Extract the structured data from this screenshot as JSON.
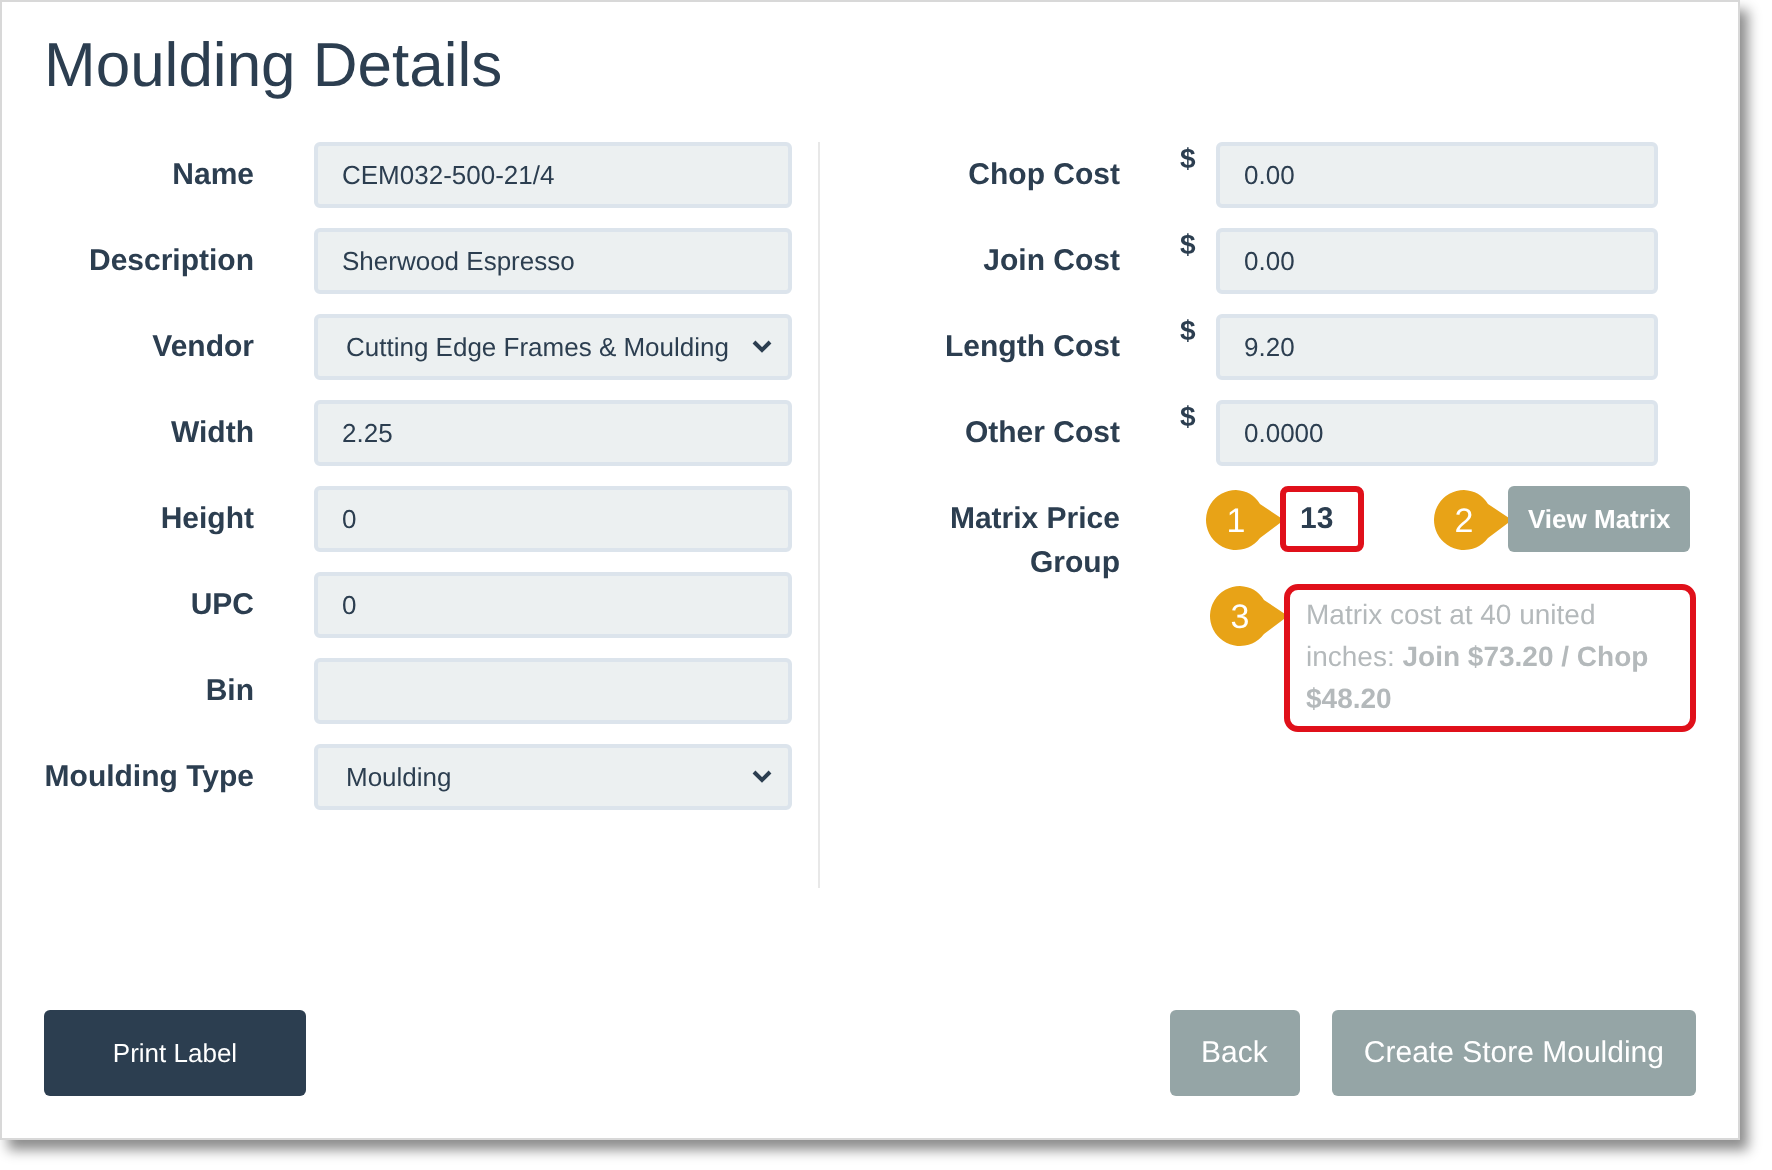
{
  "title": "Moulding Details",
  "left_fields": [
    {
      "label": "Name",
      "kind": "text",
      "value": "CEM032-500-21/4"
    },
    {
      "label": "Description",
      "kind": "text",
      "value": "Sherwood Espresso"
    },
    {
      "label": "Vendor",
      "kind": "select",
      "value": "Cutting Edge Frames & Moulding"
    },
    {
      "label": "Width",
      "kind": "text",
      "value": "2.25"
    },
    {
      "label": "Height",
      "kind": "text",
      "value": "0"
    },
    {
      "label": "UPC",
      "kind": "text",
      "value": "0"
    },
    {
      "label": "Bin",
      "kind": "text"
    },
    {
      "label": "Moulding Type",
      "kind": "select",
      "value": "Moulding"
    }
  ],
  "right_fields": [
    {
      "label": "Chop Cost",
      "currency": "$",
      "value": "0.00"
    },
    {
      "label": "Join Cost",
      "currency": "$",
      "value": "0.00"
    },
    {
      "label": "Length Cost",
      "currency": "$",
      "value": "9.20"
    },
    {
      "label": "Other Cost",
      "currency": "$",
      "value": "0.0000"
    }
  ],
  "matrix_price_group": {
    "label": "Matrix Price Group",
    "value": {
      "text": "13",
      "highlighted": true,
      "callout": "1"
    },
    "button": {
      "label": "View Matrix",
      "highlighted": false,
      "callout": "2"
    },
    "note": {
      "text": "Matrix cost at 40 united inches: **Join $73.20 / Chop $48.20**",
      "highlighted": true,
      "callout": "3"
    }
  },
  "buttons": [
    {
      "label": "Print Label",
      "kind": "primary"
    },
    {
      "label": "Back",
      "kind": "secondary"
    },
    {
      "label": "Create Store Moulding",
      "kind": "secondary"
    }
  ]
}
